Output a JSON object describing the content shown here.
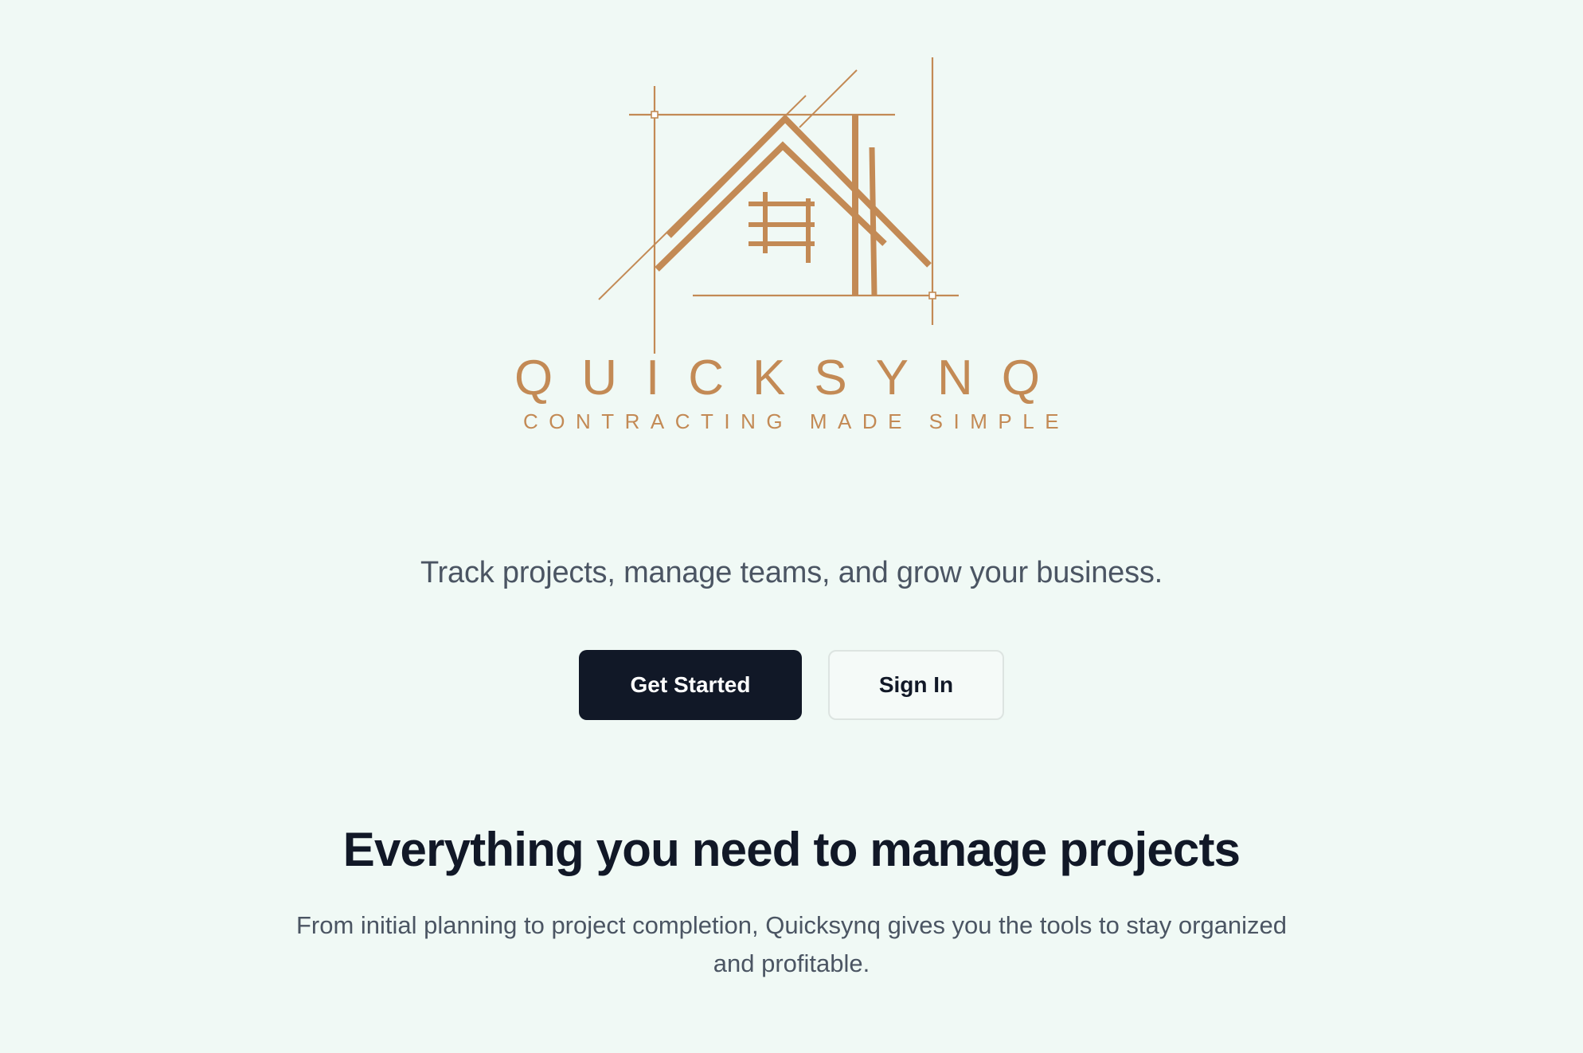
{
  "brand": {
    "name": "QUICKSYNQ",
    "slogan": "CONTRACTING MADE SIMPLE",
    "accent_color": "#c38a55"
  },
  "hero": {
    "tagline": "Track projects, manage teams, and grow your business.",
    "primary_button": "Get Started",
    "secondary_button": "Sign In"
  },
  "features": {
    "title": "Everything you need to manage projects",
    "description": "From initial planning to project completion, Quicksynq gives you the tools to stay organized and profitable."
  },
  "colors": {
    "background": "#f0f9f5",
    "primary_button_bg": "#111827",
    "text_muted": "#4b5563",
    "heading": "#111827"
  }
}
